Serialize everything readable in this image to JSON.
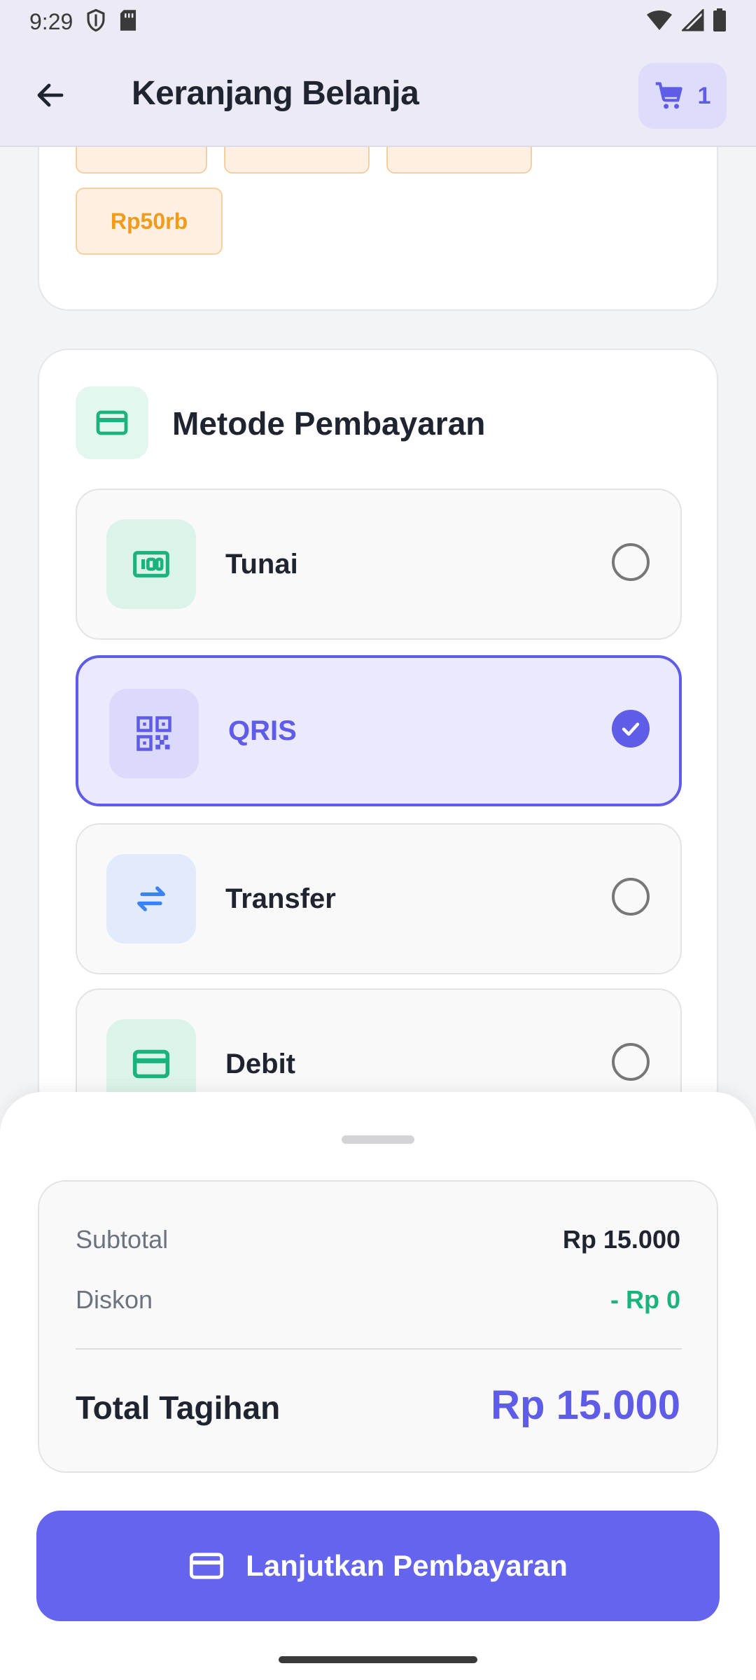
{
  "status_bar": {
    "time": "9:29",
    "icons": [
      "shield-icon",
      "sim-card-icon",
      "wifi-icon",
      "signal-icon",
      "battery-icon"
    ]
  },
  "app_bar": {
    "back_icon": "arrow-left-icon",
    "title": "Keranjang Belanja",
    "cart_icon": "cart-icon",
    "cart_count": "1"
  },
  "quick_amounts": {
    "visible_chip": "Rp50rb"
  },
  "payment": {
    "title": "Metode Pembayaran",
    "header_icon": "credit-card-icon",
    "methods": [
      {
        "label": "Tunai",
        "icon": "cash-icon",
        "selected": false
      },
      {
        "label": "QRIS",
        "icon": "qr-code-icon",
        "selected": true
      },
      {
        "label": "Transfer",
        "icon": "swap-arrows-icon",
        "selected": false
      },
      {
        "label": "Debit",
        "icon": "credit-card-icon",
        "selected": false
      }
    ]
  },
  "summary": {
    "subtotal_label": "Subtotal",
    "subtotal_value": "Rp 15.000",
    "discount_label": "Diskon",
    "discount_value": "- Rp 0",
    "total_label": "Total Tagihan",
    "total_value": "Rp 15.000"
  },
  "action": {
    "pay_button_label": "Lanjutkan Pembayaran",
    "pay_button_icon": "credit-card-icon"
  },
  "colors": {
    "primary": "#5f5ce8",
    "button": "#6464ef",
    "green": "#1bb37c",
    "orange": "#f29a1a"
  }
}
